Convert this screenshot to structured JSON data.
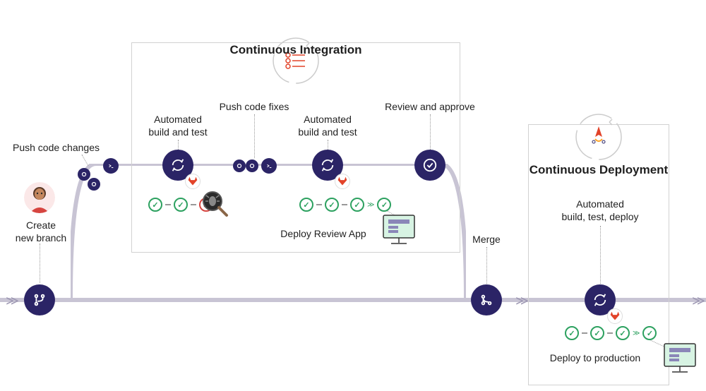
{
  "sections": {
    "ci": {
      "title": "Continuous Integration"
    },
    "cd": {
      "title": "Continuous Deployment"
    }
  },
  "steps": {
    "create_branch": "Create\nnew branch",
    "push_changes": "Push code changes",
    "auto_build_test_1": "Automated\nbuild and test",
    "push_fixes": "Push code fixes",
    "auto_build_test_2": "Automated\nbuild and test",
    "deploy_review_app": "Deploy Review App",
    "review_approve": "Review and approve",
    "merge": "Merge",
    "auto_build_test_deploy": "Automated\nbuild, test, deploy",
    "deploy_production": "Deploy to production"
  }
}
